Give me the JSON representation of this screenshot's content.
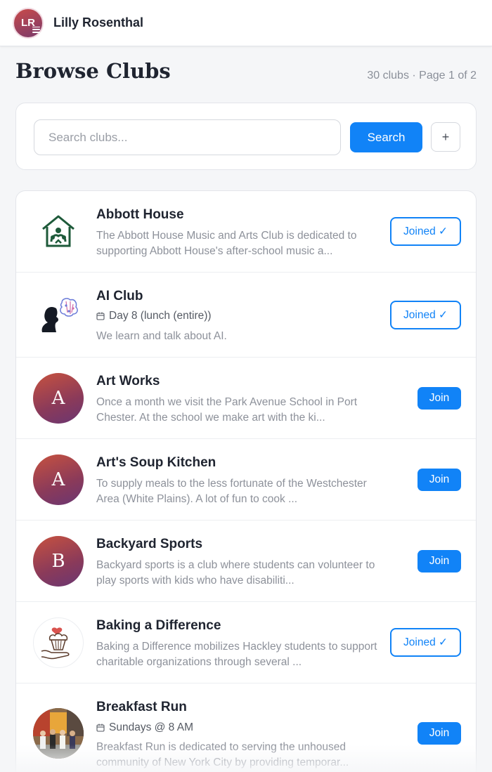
{
  "user": {
    "initials": "LR",
    "name": "Lilly Rosenthal"
  },
  "page": {
    "title": "Browse Clubs",
    "meta": "30 clubs · Page 1 of 2"
  },
  "search": {
    "placeholder": "Search clubs...",
    "value": "",
    "button_label": "Search",
    "add_label": "+"
  },
  "clubs": [
    {
      "name": "Abbott House",
      "logo": "house-heart-logo-icon",
      "meta": "",
      "description": "The Abbott House Music and Arts Club is dedicated to supporting Abbott House's after-school music a...",
      "status": "Joined ✓"
    },
    {
      "name": "AI Club",
      "logo": "head-brain-logo-icon",
      "meta": "Day 8 (lunch (entire))",
      "description": "We learn and talk about AI.",
      "status": "Joined ✓"
    },
    {
      "name": "Art Works",
      "logo_letter": "A",
      "meta": "",
      "description": "Once a month we visit the Park Avenue School in Port Chester. At the school we make art with the ki...",
      "status": "Join"
    },
    {
      "name": "Art's Soup Kitchen",
      "logo_letter": "A",
      "meta": "",
      "description": "To supply meals to the less fortunate of the Westchester Area (White Plains). A lot of fun to cook ...",
      "status": "Join"
    },
    {
      "name": "Backyard Sports",
      "logo_letter": "B",
      "meta": "",
      "description": "Backyard sports is a club where students can volunteer to play sports with kids who have disabiliti...",
      "status": "Join"
    },
    {
      "name": "Baking a Difference",
      "logo": "cupcake-hand-logo-icon",
      "meta": "",
      "description": "Baking a Difference mobilizes Hackley students to support charitable organizations through several ...",
      "status": "Joined ✓"
    },
    {
      "name": "Breakfast Run",
      "logo": "group-photo",
      "meta": "Sundays @ 8 AM",
      "description": "Breakfast Run is dedicated to serving the unhoused community of New York City by providing temporar...",
      "status": "Join"
    }
  ],
  "colors": {
    "accent": "#1183f7",
    "background": "#f5f6f8",
    "card": "#ffffff",
    "muted_text": "#8d919a"
  }
}
